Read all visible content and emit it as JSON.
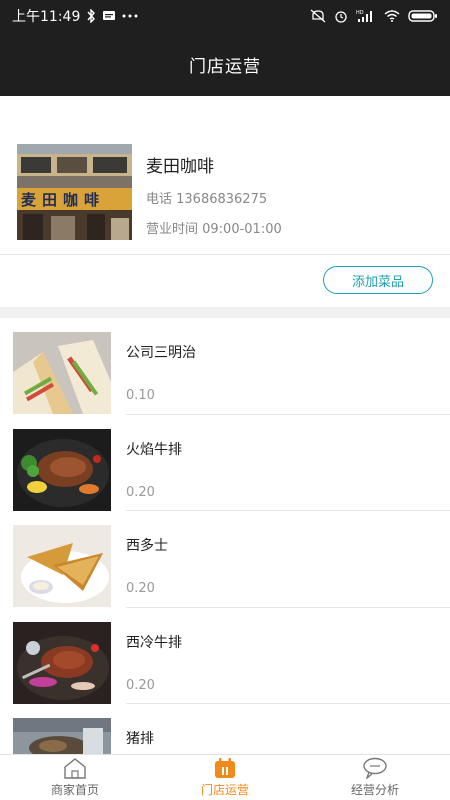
{
  "status_bar": {
    "time": "上午11:49",
    "icons_left": [
      "bluetooth-icon",
      "message-icon",
      "more-dots-icon"
    ],
    "icons_right": [
      "mute-icon",
      "alarm-icon",
      "hd-signal-icon",
      "wifi-icon",
      "battery-icon"
    ],
    "signal_label": "HD"
  },
  "header": {
    "title": "门店运营"
  },
  "shop": {
    "name": "麦田咖啡",
    "phone": "电话 13686836275",
    "hours": "营业时间 09:00-01:00",
    "sign_text": "麦田咖啡"
  },
  "actions": {
    "add_dish_label": "添加菜品"
  },
  "dishes": [
    {
      "name": "公司三明治",
      "price": "0.10"
    },
    {
      "name": "火焰牛排",
      "price": "0.20"
    },
    {
      "name": "西多士",
      "price": "0.20"
    },
    {
      "name": "西冷牛排",
      "price": "0.20"
    },
    {
      "name": "猪排",
      "price": ""
    }
  ],
  "bottom_nav": [
    {
      "label": "商家首页",
      "icon": "home-icon",
      "active": false
    },
    {
      "label": "门店运营",
      "icon": "store-calendar-icon",
      "active": true
    },
    {
      "label": "经营分析",
      "icon": "chat-bubble-icon",
      "active": false
    }
  ],
  "colors": {
    "header_bg": "#1f1f1f",
    "accent": "#1e9fb4",
    "nav_active": "#f28a1a"
  }
}
